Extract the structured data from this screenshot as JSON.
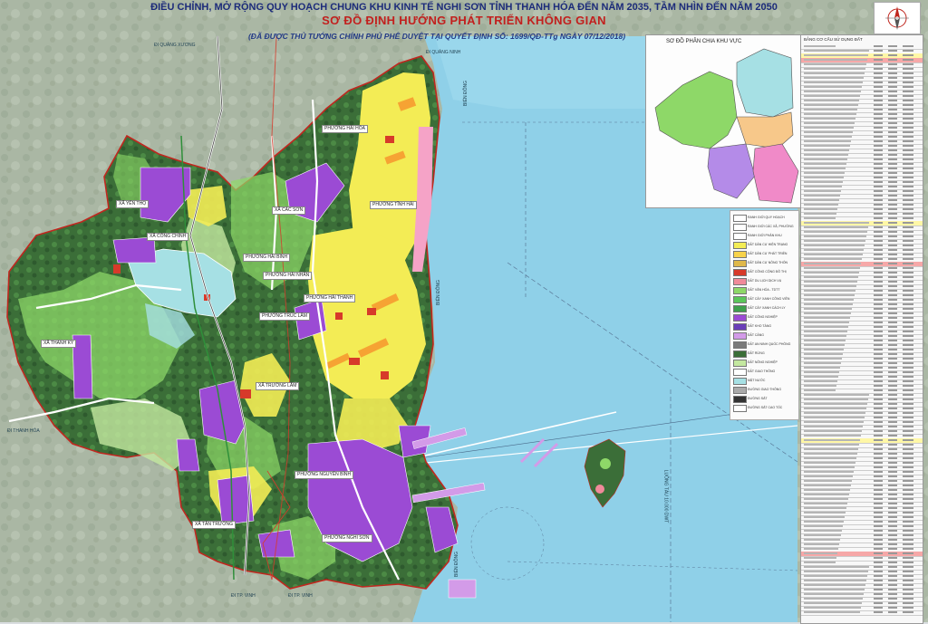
{
  "header": {
    "line1": "ĐIỀU CHỈNH, MỞ RỘNG QUY HOẠCH CHUNG KHU KINH TẾ NGHI SƠN TỈNH THANH HÓA ĐẾN NĂM 2035, TẦM NHÌN ĐẾN NĂM 2050",
    "line2": "SƠ ĐỒ ĐỊNH HƯỚNG PHÁT TRIỂN KHÔNG GIAN",
    "line3": "(ĐÃ ĐƯỢC THỦ TƯỚNG CHÍNH PHỦ PHÊ DUYỆT TẠI QUYẾT ĐỊNH SỐ: 1699/QĐ-TTg NGÀY 07/12/2018)"
  },
  "inset": {
    "title": "SƠ ĐỒ PHÂN CHIA KHU VỰC"
  },
  "map": {
    "sea_labels": [
      "BIỂN ĐÔNG",
      "BIỂN ĐÔNG",
      "BIỂN ĐÔNG"
    ],
    "shipping_lane": "LUỒNG TÀU 10.000 DWT",
    "edge_labels": {
      "north": "ĐI QUẢNG XƯƠNG",
      "north_east": "ĐI QUẢNG NINH",
      "west": "ĐI THANH HÓA",
      "south": "ĐI TP. VINH",
      "south_west": "ĐI TP. VINH"
    },
    "place_labels": [
      "XÃ YÊN THỌ",
      "XÃ TÂN TRƯỜNG",
      "XÃ THANH KỲ",
      "XÃ TRƯỜNG LÂM",
      "XÃ CÔNG CHÍNH",
      "PHƯỜNG HẢI HÒA",
      "PHƯỜNG HẢI BÌNH",
      "PHƯỜNG TĨNH HẢI",
      "PHƯỜNG HẢI THANH",
      "PHƯỜNG TRÚC LÂM",
      "PHƯỜNG NGUYÊN BÌNH",
      "PHƯỜNG HẢI NHÂN",
      "PHƯỜNG NGHI SƠN",
      "XÃ CÁC SƠN"
    ]
  },
  "colors": {
    "sea": "#8fd0e8",
    "forest": "#3b6e38",
    "green_light": "#8ed868",
    "urban_yellow": "#f3ec55",
    "industrial_purple": "#9b4bd4",
    "commercial_red": "#d73a2a",
    "lake": "#a6e0e4",
    "boundary": "#c0271f"
  },
  "legend": {
    "items": [
      {
        "label": "RANH GIỚI QUY HOẠCH",
        "color": "#ffffff"
      },
      {
        "label": "RANH GIỚI CÁC XÃ, PHƯỜNG",
        "color": "#ffffff"
      },
      {
        "label": "RANH GIỚI PHÂN KHU",
        "color": "#ffffff"
      },
      {
        "label": "ĐẤT DÂN CƯ HIỆN TRẠNG",
        "color": "#f3ec55"
      },
      {
        "label": "ĐẤT DÂN CƯ PHÁT TRIỂN",
        "color": "#f7d24a"
      },
      {
        "label": "ĐẤT DÂN CƯ NÔNG THÔN",
        "color": "#e0b84a"
      },
      {
        "label": "ĐẤT CÔNG CỘNG ĐÔ THỊ",
        "color": "#d73a2a"
      },
      {
        "label": "ĐẤT DU LỊCH DỊCH VỤ",
        "color": "#f08a9a"
      },
      {
        "label": "ĐẤT VĂN HÓA - TDTT",
        "color": "#8ed868"
      },
      {
        "label": "ĐẤT CÂY XANH CÔNG VIÊN",
        "color": "#5cc65a"
      },
      {
        "label": "ĐẤT CÂY XANH CÁCH LY",
        "color": "#3fa04c"
      },
      {
        "label": "ĐẤT CÔNG NGHIỆP",
        "color": "#9b4bd4"
      },
      {
        "label": "ĐẤT KHO TÀNG",
        "color": "#6a3fb8"
      },
      {
        "label": "ĐẤT CẢNG",
        "color": "#d39be8"
      },
      {
        "label": "ĐẤT AN NINH QUỐC PHÒNG",
        "color": "#7a7a7a"
      },
      {
        "label": "ĐẤT RỪNG",
        "color": "#3b6e38"
      },
      {
        "label": "ĐẤT NÔNG NGHIỆP",
        "color": "#c4e8a0"
      },
      {
        "label": "ĐẤT GIAO THÔNG",
        "color": "#ffffff"
      },
      {
        "label": "MẶT NƯỚC",
        "color": "#a6e0e4"
      },
      {
        "label": "ĐƯỜNG GIAO THÔNG",
        "color": "#aaaaaa"
      },
      {
        "label": "ĐƯỜNG SẮT",
        "color": "#333333"
      },
      {
        "label": "ĐƯỜNG SẮT CAO TỐC",
        "color": "#ffffff"
      }
    ]
  },
  "table": {
    "header": "BẢNG CƠ CẤU SỬ DỤNG ĐẤT"
  }
}
